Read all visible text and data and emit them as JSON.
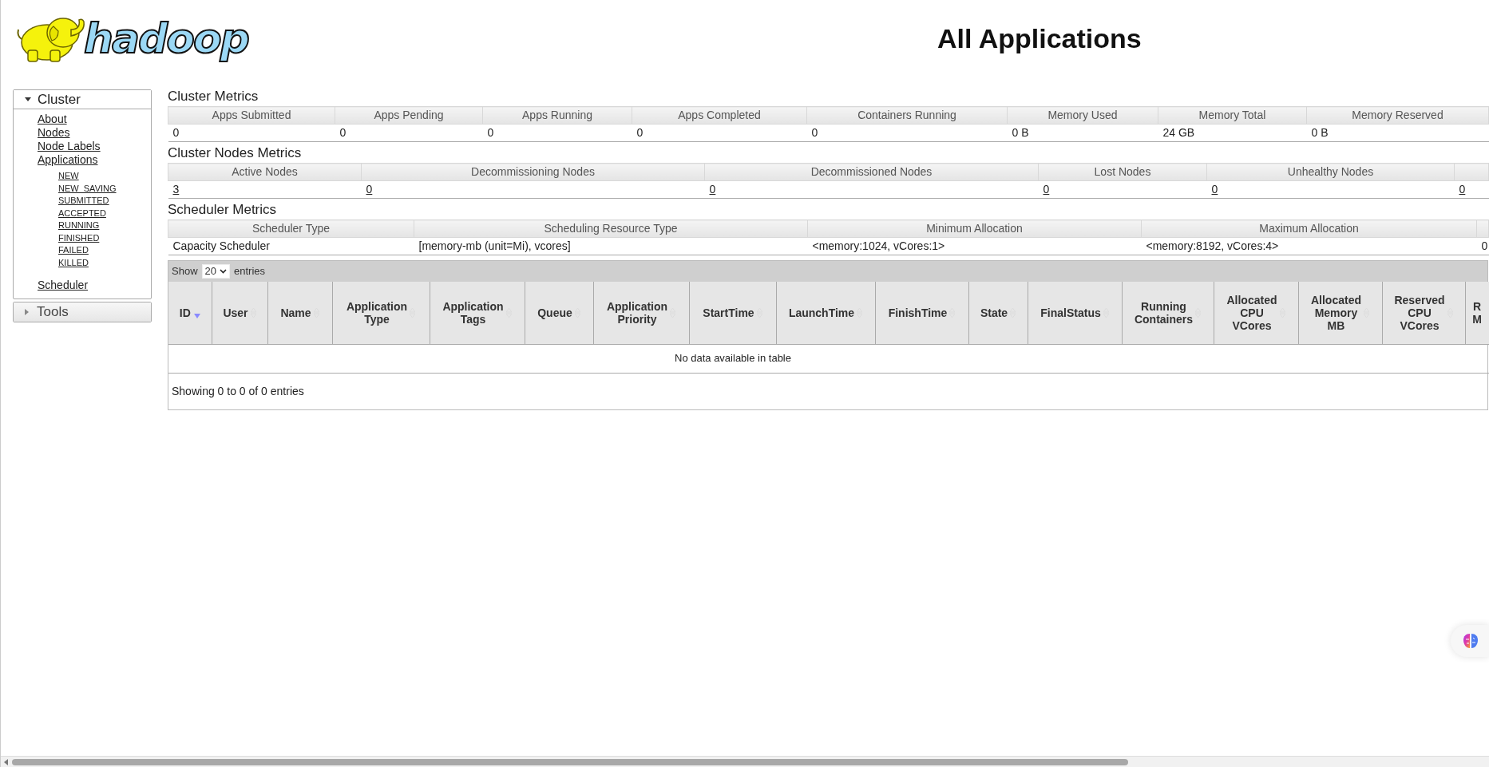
{
  "logo": {
    "text": "hadoop"
  },
  "title": "All Applications",
  "sidebar": [
    {
      "label": "Cluster",
      "expanded": true,
      "links": [
        {
          "label": "About"
        },
        {
          "label": "Nodes"
        },
        {
          "label": "Node Labels"
        },
        {
          "label": "Applications",
          "children": [
            {
              "label": "NEW"
            },
            {
              "label": "NEW_SAVING"
            },
            {
              "label": "SUBMITTED"
            },
            {
              "label": "ACCEPTED"
            },
            {
              "label": "RUNNING"
            },
            {
              "label": "FINISHED"
            },
            {
              "label": "FAILED"
            },
            {
              "label": "KILLED"
            }
          ]
        },
        {
          "label": "Scheduler"
        }
      ]
    },
    {
      "label": "Tools",
      "expanded": false
    }
  ],
  "cluster_metrics": {
    "heading": "Cluster Metrics",
    "columns": [
      "Apps Submitted",
      "Apps Pending",
      "Apps Running",
      "Apps Completed",
      "Containers Running",
      "Memory Used",
      "Memory Total",
      "Memory Reserved"
    ],
    "values": [
      {
        "text": "0",
        "link": false
      },
      {
        "text": "0",
        "link": false
      },
      {
        "text": "0",
        "link": false
      },
      {
        "text": "0",
        "link": false
      },
      {
        "text": "0",
        "link": false
      },
      {
        "text": "0 B",
        "link": false
      },
      {
        "text": "24 GB",
        "link": false
      },
      {
        "text": "0 B",
        "link": false
      }
    ]
  },
  "cluster_nodes_metrics": {
    "heading": "Cluster Nodes Metrics",
    "columns": [
      "Active Nodes",
      "Decommissioning Nodes",
      "Decommissioned Nodes",
      "Lost Nodes",
      "Unhealthy Nodes"
    ],
    "values": [
      {
        "text": "3",
        "link": true
      },
      {
        "text": "0",
        "link": true
      },
      {
        "text": "0",
        "link": true
      },
      {
        "text": "0",
        "link": true
      },
      {
        "text": "0",
        "link": true
      },
      {
        "text": "0",
        "link": true
      }
    ]
  },
  "scheduler_metrics": {
    "heading": "Scheduler Metrics",
    "columns": [
      "Scheduler Type",
      "Scheduling Resource Type",
      "Minimum Allocation",
      "Maximum Allocation"
    ],
    "values": [
      {
        "text": "Capacity Scheduler",
        "link": false
      },
      {
        "text": "[memory-mb (unit=Mi), vcores]",
        "link": false
      },
      {
        "text": "<memory:1024, vCores:1>",
        "link": false
      },
      {
        "text": "<memory:8192, vCores:4>",
        "link": false
      },
      {
        "text": "0",
        "link": false
      }
    ]
  },
  "applications": {
    "length_label_before": "Show",
    "length_value": "20",
    "length_label_after": "entries",
    "columns": [
      {
        "lines": [
          "ID"
        ],
        "sorted": true
      },
      {
        "lines": [
          "User"
        ],
        "sorted": false
      },
      {
        "lines": [
          "Name"
        ],
        "sorted": false
      },
      {
        "lines": [
          "Application",
          "Type"
        ],
        "sorted": false
      },
      {
        "lines": [
          "Application",
          "Tags"
        ],
        "sorted": false
      },
      {
        "lines": [
          "Queue"
        ],
        "sorted": false
      },
      {
        "lines": [
          "Application",
          "Priority"
        ],
        "sorted": false
      },
      {
        "lines": [
          "StartTime"
        ],
        "sorted": false
      },
      {
        "lines": [
          "LaunchTime"
        ],
        "sorted": false
      },
      {
        "lines": [
          "FinishTime"
        ],
        "sorted": false
      },
      {
        "lines": [
          "State"
        ],
        "sorted": false
      },
      {
        "lines": [
          "FinalStatus"
        ],
        "sorted": false
      },
      {
        "lines": [
          "Running",
          "Containers"
        ],
        "sorted": false
      },
      {
        "lines": [
          "Allocated",
          "CPU",
          "VCores"
        ],
        "sorted": false
      },
      {
        "lines": [
          "Allocated",
          "Memory",
          "MB"
        ],
        "sorted": false
      },
      {
        "lines": [
          "Reserved",
          "CPU",
          "VCores"
        ],
        "sorted": false
      },
      {
        "lines": [
          "R",
          "M"
        ]
      }
    ],
    "empty_message": "No data available in table",
    "info": "Showing 0 to 0 of 0 entries"
  }
}
